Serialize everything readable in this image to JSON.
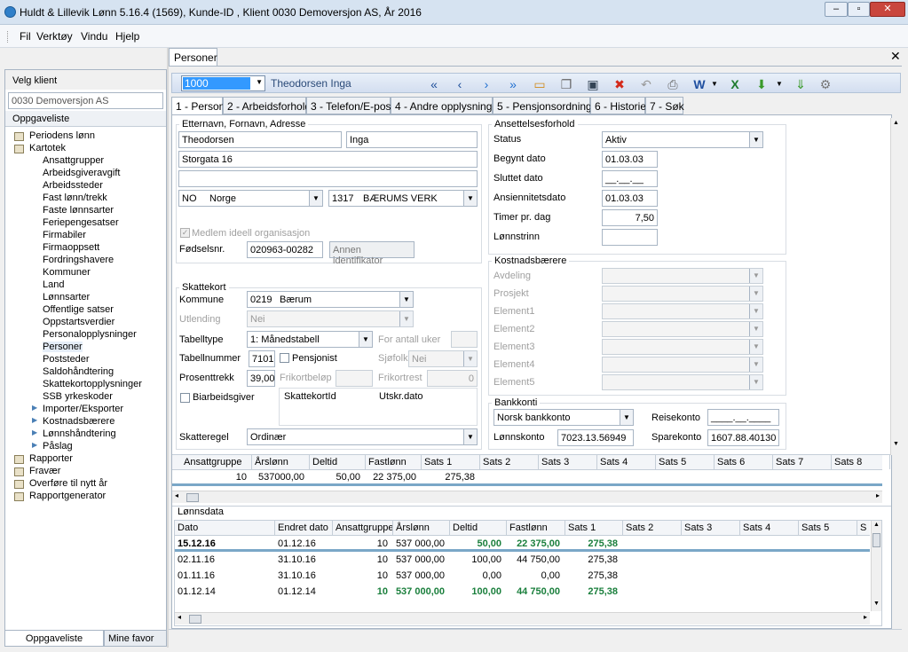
{
  "window": {
    "title": "Huldt & Lillevik Lønn 5.16.4 (1569), Kunde-ID , Klient 0030 Demoversjon AS, År 2016"
  },
  "menu": [
    "Fil",
    "Verktøy",
    "Vindu",
    "Hjelp"
  ],
  "doc_tab": "Personer",
  "left": {
    "header": "Velg klient",
    "client": "0030  Demoversjon AS",
    "tasks_header": "Oppgaveliste",
    "tree": [
      {
        "label": "Periodens lønn",
        "level": 0
      },
      {
        "label": "Kartotek",
        "level": 0
      },
      {
        "label": "Ansattgrupper",
        "level": 2
      },
      {
        "label": "Arbeidsgiveravgift",
        "level": 2
      },
      {
        "label": "Arbeidssteder",
        "level": 2
      },
      {
        "label": "Fast lønn/trekk",
        "level": 2
      },
      {
        "label": "Faste lønnsarter",
        "level": 2
      },
      {
        "label": "Feriepengesatser",
        "level": 2
      },
      {
        "label": "Firmabiler",
        "level": 2
      },
      {
        "label": "Firmaoppsett",
        "level": 2
      },
      {
        "label": "Fordringshavere",
        "level": 2
      },
      {
        "label": "Kommuner",
        "level": 2
      },
      {
        "label": "Land",
        "level": 2
      },
      {
        "label": "Lønnsarter",
        "level": 2
      },
      {
        "label": "Offentlige satser",
        "level": 2
      },
      {
        "label": "Oppstartsverdier",
        "level": 2
      },
      {
        "label": "Personalopplysninger",
        "level": 2
      },
      {
        "label": "Personer",
        "level": 2
      },
      {
        "label": "Poststeder",
        "level": 2
      },
      {
        "label": "Saldohåndtering",
        "level": 2
      },
      {
        "label": "Skattekortopplysninger",
        "level": 2
      },
      {
        "label": "SSB yrkeskoder",
        "level": 2
      },
      {
        "label": "Importer/Eksporter",
        "level": 1
      },
      {
        "label": "Kostnadsbærere",
        "level": 1
      },
      {
        "label": "Lønnshåndtering",
        "level": 1
      },
      {
        "label": "Påslag",
        "level": 1
      },
      {
        "label": "Rapporter",
        "level": 0
      },
      {
        "label": "Fravær",
        "level": 0
      },
      {
        "label": "Overføre til nytt år",
        "level": 0
      },
      {
        "label": "Rapportgenerator",
        "level": 0
      }
    ],
    "bottom_tabs": [
      "Oppgaveliste",
      "Mine favor"
    ]
  },
  "toolbar": {
    "person_id": "1000",
    "person_name": "Theodorsen Inga"
  },
  "tabs": [
    "1 - Person",
    "2 - Arbeidsforhold",
    "3 - Telefon/E-post",
    "4 - Andre opplysninger",
    "5 - Pensjonsordning",
    "6 - Historie",
    "7 - Søk"
  ],
  "person": {
    "group_label": "Etternavn, Fornavn, Adresse",
    "lastname": "Theodorsen",
    "firstname": "Inga",
    "address1": "Storgata 16",
    "address2": "",
    "country_code": "NO",
    "country": "Norge",
    "postal_code": "1317",
    "postal_place": "BÆRUMS VERK",
    "member_label": "Medlem ideell organisasjon",
    "fnr_label": "Fødselsnr.",
    "fnr": "020963-00282",
    "other_id_button": "Annen identifikator"
  },
  "employment": {
    "group_label": "Ansettelsesforhold",
    "status_label": "Status",
    "status": "Aktiv",
    "start_label": "Begynt dato",
    "start": "01.03.03",
    "end_label": "Sluttet dato",
    "end": "__.__.__",
    "seniority_label": "Ansiennitetsdato",
    "seniority": "01.03.03",
    "hours_label": "Timer pr. dag",
    "hours": "7,50",
    "step_label": "Lønnstrinn",
    "step": ""
  },
  "cost": {
    "group_label": "Kostnadsbærere",
    "items": [
      "Avdeling",
      "Prosjekt",
      "Element1",
      "Element2",
      "Element3",
      "Element4",
      "Element5"
    ]
  },
  "tax": {
    "group_label": "Skattekort",
    "kommune_label": "Kommune",
    "kommune_code": "0219",
    "kommune": "Bærum",
    "utlending_label": "Utlending",
    "utlending": "Nei",
    "tabelltype_label": "Tabelltype",
    "tabelltype": "1: Månedstabell",
    "antall_uker_label": "For antall uker",
    "tabellnr_label": "Tabellnummer",
    "tabellnr": "7101",
    "pensjonist_label": "Pensjonist",
    "sjofolk_label": "Sjøfolk",
    "sjofolk": "Nei",
    "prosent_label": "Prosenttrekk",
    "prosent": "39,00",
    "frikort_label": "Frikortbeløp",
    "frikortrest_label": "Frikortrest",
    "frikortrest": "0",
    "biarbeid_label": "Biarbeidsgiver",
    "skattekortid_label": "SkattekortId",
    "utskr_label": "Utskr.dato",
    "regel_label": "Skatteregel",
    "regel": "Ordinær"
  },
  "bank": {
    "group_label": "Bankkonti",
    "type": "Norsk bankkonto",
    "lonn_label": "Lønnskonto",
    "lonn": "7023.13.56949",
    "reise_label": "Reisekonto",
    "reise": "____.__.____",
    "spare_label": "Sparekonto",
    "spare": "1607.88.40130"
  },
  "salary_grid": {
    "headers": [
      "Ansattgruppe",
      "Årslønn",
      "Deltid",
      "Fastlønn",
      "Sats 1",
      "Sats 2",
      "Sats 3",
      "Sats 4",
      "Sats 5",
      "Sats 6",
      "Sats 7",
      "Sats 8"
    ],
    "row": [
      "10",
      "537000,00",
      "50,00",
      "22 375,00",
      "275,38",
      "",
      "",
      "",
      "",
      "",
      "",
      ""
    ]
  },
  "history": {
    "title": "Lønnsdata",
    "headers": [
      "Dato",
      "Endret dato",
      "Ansattgruppe",
      "Årslønn",
      "Deltid",
      "Fastlønn",
      "Sats 1",
      "Sats 2",
      "Sats 3",
      "Sats 4",
      "Sats 5",
      "S"
    ],
    "rows": [
      {
        "cells": [
          "15.12.16",
          "01.12.16",
          "10",
          "537 000,00",
          "50,00",
          "22 375,00",
          "275,38"
        ],
        "style": "bold-green"
      },
      {
        "cells": [
          "02.11.16",
          "31.10.16",
          "10",
          "537 000,00",
          "100,00",
          "44 750,00",
          "275,38"
        ],
        "style": "normal"
      },
      {
        "cells": [
          "01.11.16",
          "31.10.16",
          "10",
          "537 000,00",
          "0,00",
          "0,00",
          "275,38"
        ],
        "style": "normal"
      },
      {
        "cells": [
          "01.12.14",
          "01.12.14",
          "10",
          "537 000,00",
          "100,00",
          "44 750,00",
          "275,38"
        ],
        "style": "green"
      }
    ]
  }
}
